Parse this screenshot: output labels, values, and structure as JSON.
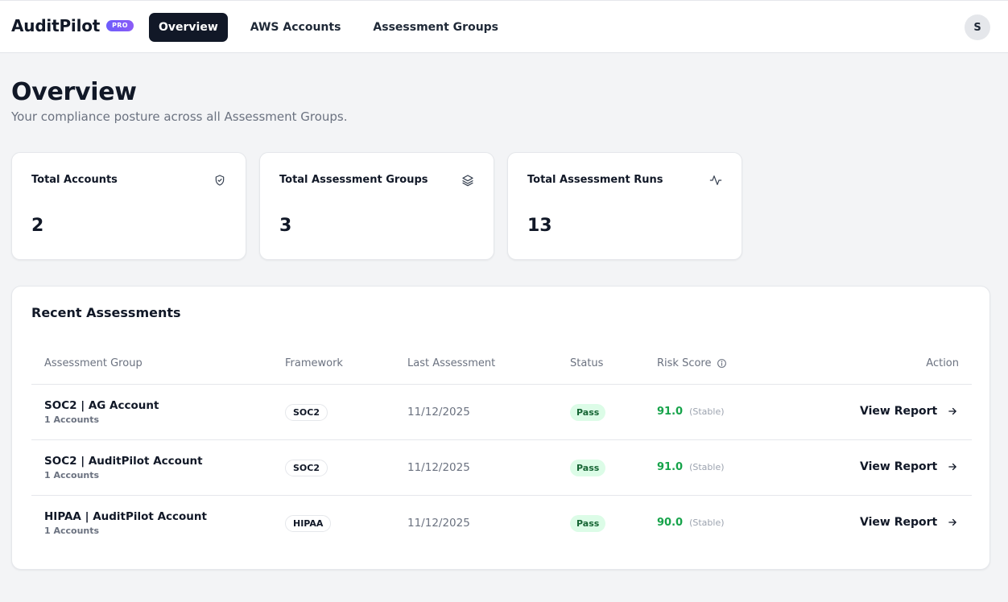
{
  "app": {
    "name": "AuditPilot",
    "badge": "PRO",
    "accent": "#7c3aed"
  },
  "nav": {
    "items": [
      {
        "label": "Overview",
        "active": true
      },
      {
        "label": "AWS Accounts",
        "active": false
      },
      {
        "label": "Assessment Groups",
        "active": false
      }
    ]
  },
  "user": {
    "initial": "S"
  },
  "page": {
    "title": "Overview",
    "subtitle": "Your compliance posture across all Assessment Groups."
  },
  "stats": [
    {
      "label": "Total Accounts",
      "value": "2",
      "icon": "shield-check-icon"
    },
    {
      "label": "Total Assessment Groups",
      "value": "3",
      "icon": "layers-icon"
    },
    {
      "label": "Total Assessment Runs",
      "value": "13",
      "icon": "activity-icon"
    }
  ],
  "recent": {
    "title": "Recent Assessments",
    "columns": {
      "group": "Assessment Group",
      "framework": "Framework",
      "last": "Last Assessment",
      "status": "Status",
      "risk": "Risk Score",
      "action": "Action"
    },
    "rows": [
      {
        "group": "SOC2 | AG Account",
        "accounts": "1 Accounts",
        "framework": "SOC2",
        "last": "11/12/2025",
        "status": "Pass",
        "score": "91.0",
        "trend": "(Stable)",
        "action": "View Report"
      },
      {
        "group": "SOC2 | AuditPilot Account",
        "accounts": "1 Accounts",
        "framework": "SOC2",
        "last": "11/12/2025",
        "status": "Pass",
        "score": "91.0",
        "trend": "(Stable)",
        "action": "View Report"
      },
      {
        "group": "HIPAA | AuditPilot Account",
        "accounts": "1 Accounts",
        "framework": "HIPAA",
        "last": "11/12/2025",
        "status": "Pass",
        "score": "90.0",
        "trend": "(Stable)",
        "action": "View Report"
      }
    ]
  },
  "colors": {
    "pass_bg": "#dcfce7",
    "pass_text": "#166534",
    "score": "#16a34a",
    "nav_active": "#111827"
  }
}
